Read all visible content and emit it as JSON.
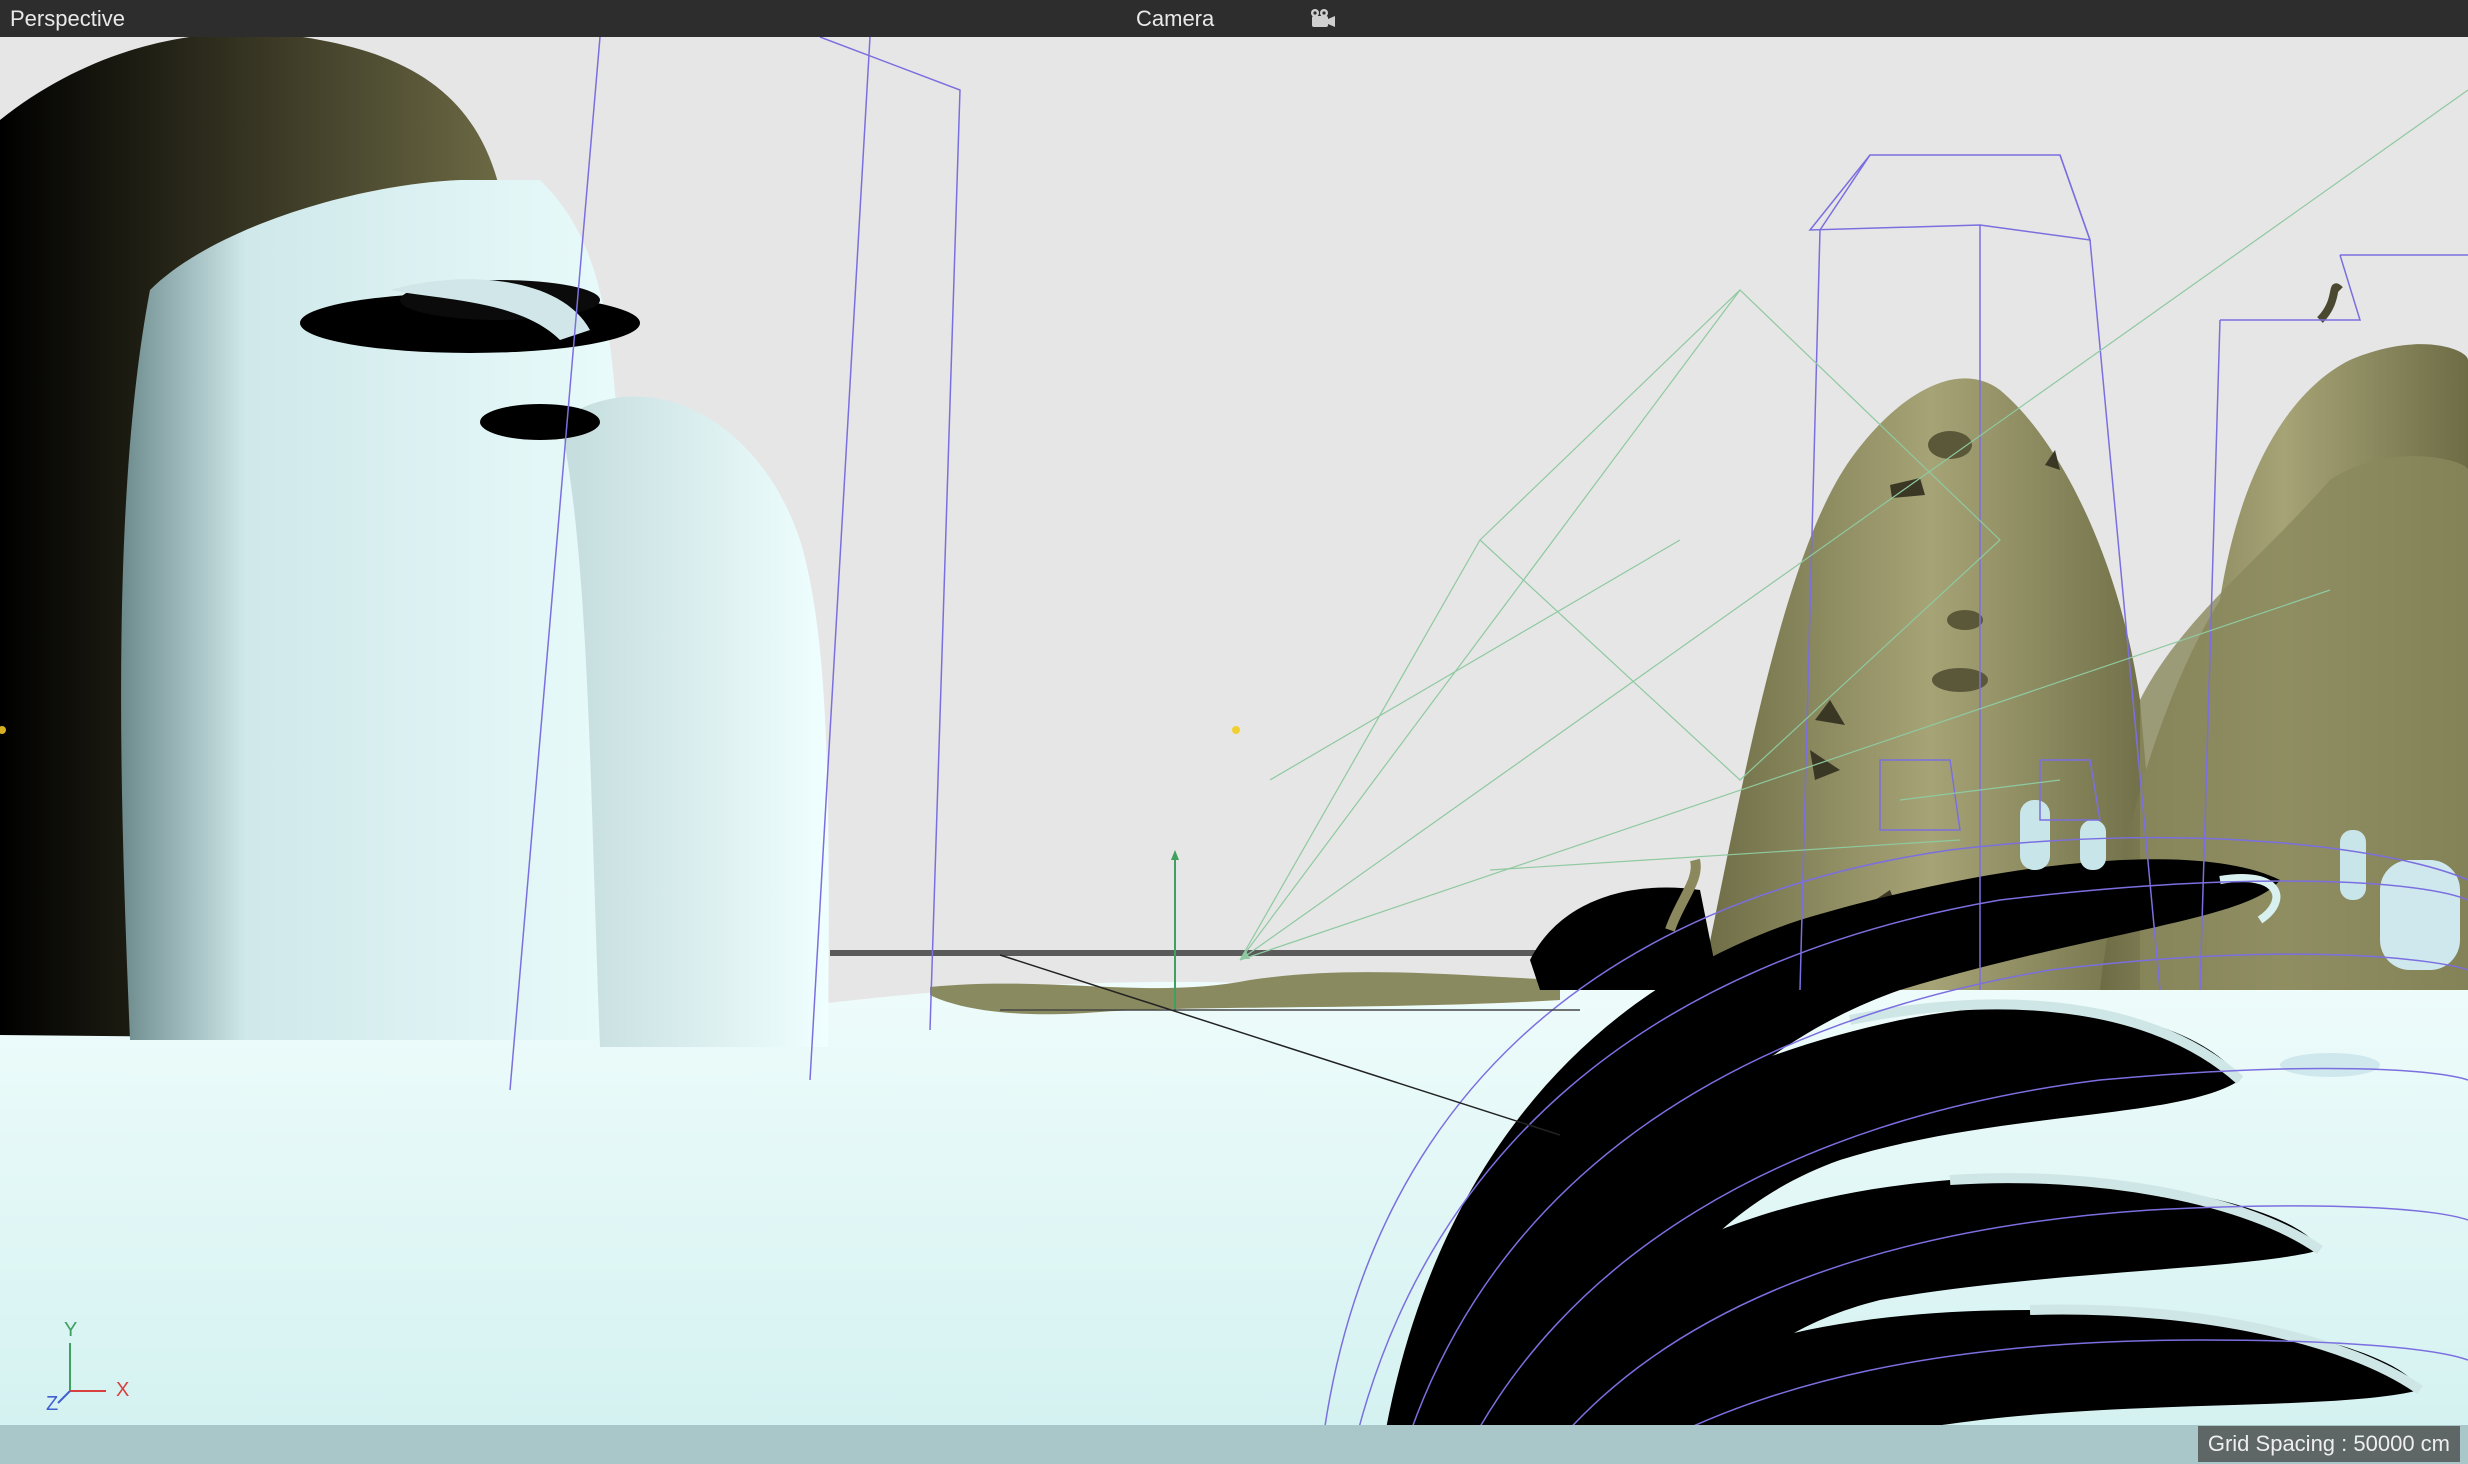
{
  "viewport": {
    "view_name": "Perspective",
    "camera_label": "Camera",
    "camera_icon": "camera-icon",
    "grid_spacing_text": "Grid Spacing : 50000 cm"
  },
  "axis_gizmo": {
    "y_label": "Y",
    "x_label": "X",
    "z_label": "Z"
  },
  "colors": {
    "toolbar_bg": "#2d2d2d",
    "background": "#e6e6e6",
    "snow": "#d8f2f2",
    "rock": "#8c8a5c",
    "wireframe": "#7b6fe0",
    "spline_green": "#8fc9a0",
    "x_axis": "#d84040",
    "y_axis": "#3fa060",
    "z_axis": "#4060d0"
  }
}
